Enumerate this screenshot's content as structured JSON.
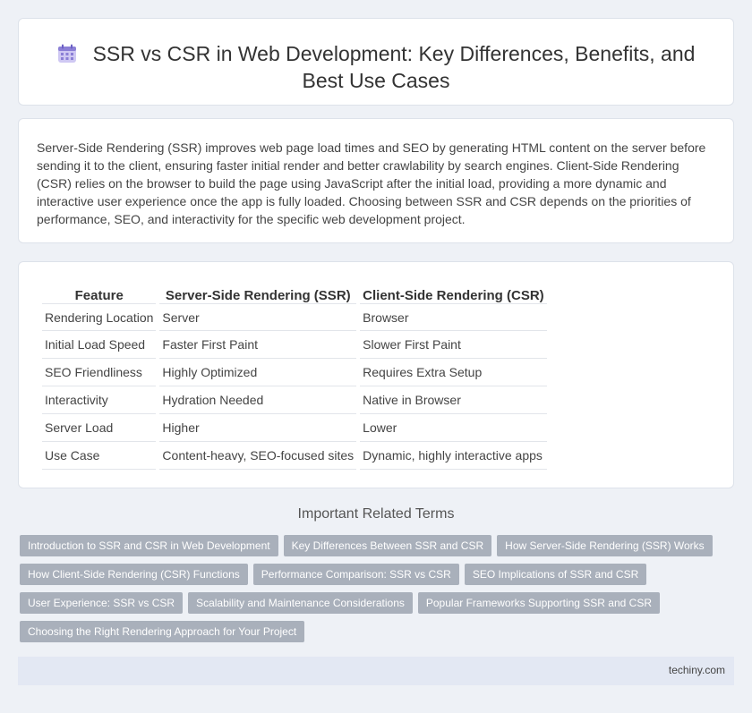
{
  "header": {
    "title": "SSR vs CSR in Web Development: Key Differences, Benefits, and Best Use Cases",
    "icon": "calendar-icon"
  },
  "intro": {
    "text": "Server-Side Rendering (SSR) improves web page load times and SEO by generating HTML content on the server before sending it to the client, ensuring faster initial render and better crawlability by search engines. Client-Side Rendering (CSR) relies on the browser to build the page using JavaScript after the initial load, providing a more dynamic and interactive user experience once the app is fully loaded. Choosing between SSR and CSR depends on the priorities of performance, SEO, and interactivity for the specific web development project."
  },
  "table": {
    "headers": [
      "Feature",
      "Server-Side Rendering (SSR)",
      "Client-Side Rendering (CSR)"
    ],
    "rows": [
      [
        "Rendering Location",
        "Server",
        "Browser"
      ],
      [
        "Initial Load Speed",
        "Faster First Paint",
        "Slower First Paint"
      ],
      [
        "SEO Friendliness",
        "Highly Optimized",
        "Requires Extra Setup"
      ],
      [
        "Interactivity",
        "Hydration Needed",
        "Native in Browser"
      ],
      [
        "Server Load",
        "Higher",
        "Lower"
      ],
      [
        "Use Case",
        "Content-heavy, SEO-focused sites",
        "Dynamic, highly interactive apps"
      ]
    ]
  },
  "related": {
    "heading": "Important Related Terms",
    "tags": [
      "Introduction to SSR and CSR in Web Development",
      "Key Differences Between SSR and CSR",
      "How Server-Side Rendering (SSR) Works",
      "How Client-Side Rendering (CSR) Functions",
      "Performance Comparison: SSR vs CSR",
      "SEO Implications of SSR and CSR",
      "User Experience: SSR vs CSR",
      "Scalability and Maintenance Considerations",
      "Popular Frameworks Supporting SSR and CSR",
      "Choosing the Right Rendering Approach for Your Project"
    ]
  },
  "footer": {
    "site": "techiny.com"
  },
  "colors": {
    "background": "#eef1f6",
    "tag": "#a9b0bb",
    "footer": "#e3e8f3",
    "icon": "#8b7fd6"
  }
}
